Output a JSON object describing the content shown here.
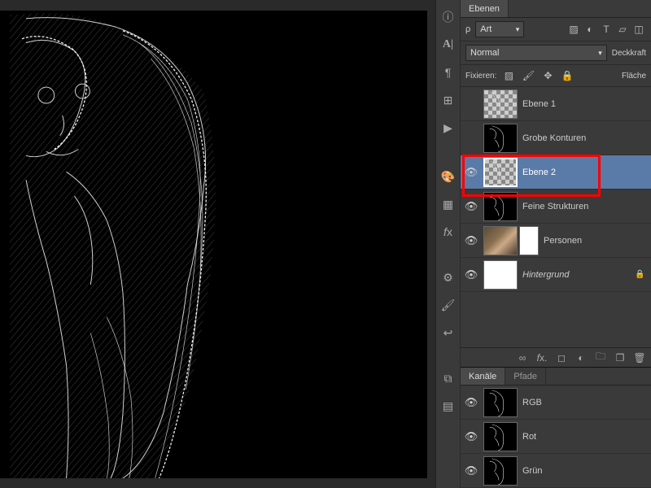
{
  "panel": {
    "tabs": {
      "layers": "Ebenen",
      "channels": "Kanäle",
      "paths": "Pfade"
    },
    "kind_label": "Art",
    "blend_mode": "Normal",
    "opacity_label": "Deckkraft",
    "lock_label": "Fixieren:",
    "fill_label": "Fläche"
  },
  "layers": [
    {
      "name": "Ebene 1",
      "visible": false,
      "selected": false,
      "italic": false,
      "thumb": "checker-strip"
    },
    {
      "name": "Grobe Konturen",
      "visible": false,
      "selected": false,
      "italic": false,
      "thumb": "edge"
    },
    {
      "name": "Ebene 2",
      "visible": true,
      "selected": true,
      "italic": false,
      "thumb": "checker-strip",
      "highlight": true
    },
    {
      "name": "Feine Strukturen",
      "visible": true,
      "selected": false,
      "italic": false,
      "thumb": "edge"
    },
    {
      "name": "Personen",
      "visible": true,
      "selected": false,
      "italic": false,
      "thumb": "photo",
      "mask": true
    },
    {
      "name": "Hintergrund",
      "visible": true,
      "selected": false,
      "italic": true,
      "thumb": "white",
      "locked": true
    }
  ],
  "channels": [
    {
      "name": "RGB",
      "visible": true
    },
    {
      "name": "Rot",
      "visible": true
    },
    {
      "name": "Grün",
      "visible": true
    }
  ],
  "footer_icons": [
    "link",
    "fx",
    "mask",
    "adjust",
    "folder",
    "new",
    "trash"
  ]
}
